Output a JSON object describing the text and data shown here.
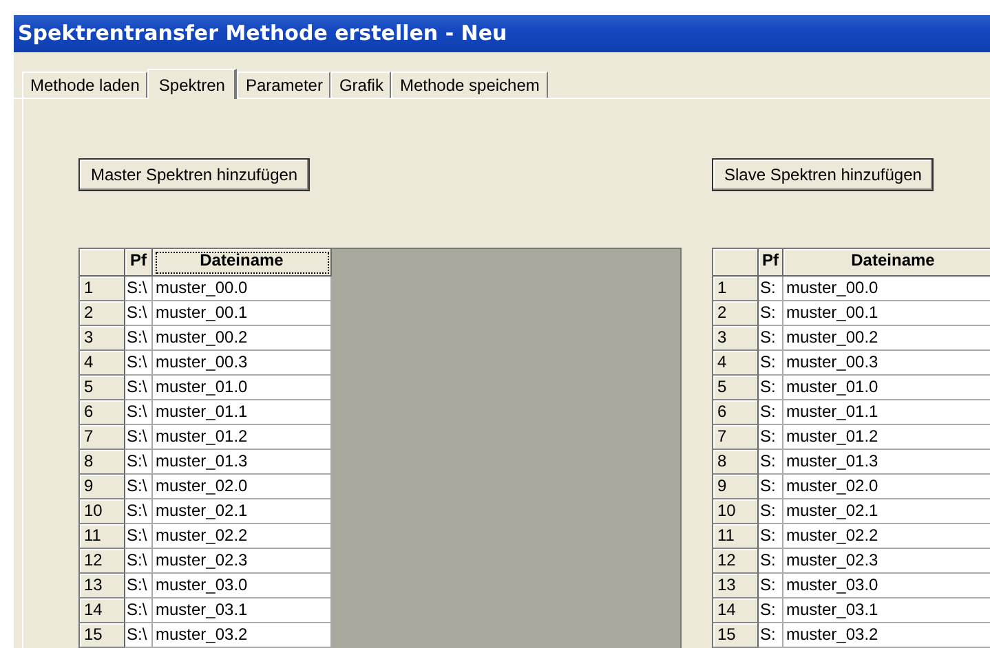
{
  "window": {
    "title": "Spektrentransfer Methode erstellen  -  Neu"
  },
  "tabs": [
    {
      "label": "Methode laden",
      "selected": false
    },
    {
      "label": "Spektren",
      "selected": true
    },
    {
      "label": "Parameter",
      "selected": false
    },
    {
      "label": "Grafik",
      "selected": false
    },
    {
      "label": "Methode speichem",
      "selected": false
    }
  ],
  "grids": [
    {
      "button": "Master Spektren hinzufügen",
      "columns": [
        {
          "label": "Pf",
          "focused": false
        },
        {
          "label": "Dateiname",
          "focused": true
        }
      ],
      "rows": [
        {
          "number": "1",
          "path": "S:\\",
          "file": "muster_00.0"
        },
        {
          "number": "2",
          "path": "S:\\",
          "file": "muster_00.1"
        },
        {
          "number": "3",
          "path": "S:\\",
          "file": "muster_00.2"
        },
        {
          "number": "4",
          "path": "S:\\",
          "file": "muster_00.3"
        },
        {
          "number": "5",
          "path": "S:\\",
          "file": "muster_01.0"
        },
        {
          "number": "6",
          "path": "S:\\",
          "file": "muster_01.1"
        },
        {
          "number": "7",
          "path": "S:\\",
          "file": "muster_01.2"
        },
        {
          "number": "8",
          "path": "S:\\",
          "file": "muster_01.3"
        },
        {
          "number": "9",
          "path": "S:\\",
          "file": "muster_02.0"
        },
        {
          "number": "10",
          "path": "S:\\",
          "file": "muster_02.1"
        },
        {
          "number": "11",
          "path": "S:\\",
          "file": "muster_02.2"
        },
        {
          "number": "12",
          "path": "S:\\",
          "file": "muster_02.3"
        },
        {
          "number": "13",
          "path": "S:\\",
          "file": "muster_03.0"
        },
        {
          "number": "14",
          "path": "S:\\",
          "file": "muster_03.1"
        },
        {
          "number": "15",
          "path": "S:\\",
          "file": "muster_03.2"
        }
      ]
    },
    {
      "button": "Slave Spektren hinzufügen",
      "columns": [
        {
          "label": "Pf",
          "focused": false
        },
        {
          "label": "Dateiname",
          "focused": false
        }
      ],
      "rows": [
        {
          "number": "1",
          "path": "S:",
          "file": "muster_00.0"
        },
        {
          "number": "2",
          "path": "S:",
          "file": "muster_00.1"
        },
        {
          "number": "3",
          "path": "S:",
          "file": "muster_00.2"
        },
        {
          "number": "4",
          "path": "S:",
          "file": "muster_00.3"
        },
        {
          "number": "5",
          "path": "S:",
          "file": "muster_01.0"
        },
        {
          "number": "6",
          "path": "S:",
          "file": "muster_01.1"
        },
        {
          "number": "7",
          "path": "S:",
          "file": "muster_01.2"
        },
        {
          "number": "8",
          "path": "S:",
          "file": "muster_01.3"
        },
        {
          "number": "9",
          "path": "S:",
          "file": "muster_02.0"
        },
        {
          "number": "10",
          "path": "S:",
          "file": "muster_02.1"
        },
        {
          "number": "11",
          "path": "S:",
          "file": "muster_02.2"
        },
        {
          "number": "12",
          "path": "S:",
          "file": "muster_02.3"
        },
        {
          "number": "13",
          "path": "S:",
          "file": "muster_03.0"
        },
        {
          "number": "14",
          "path": "S:",
          "file": "muster_03.1"
        },
        {
          "number": "15",
          "path": "S:",
          "file": "muster_03.2"
        }
      ]
    }
  ]
}
